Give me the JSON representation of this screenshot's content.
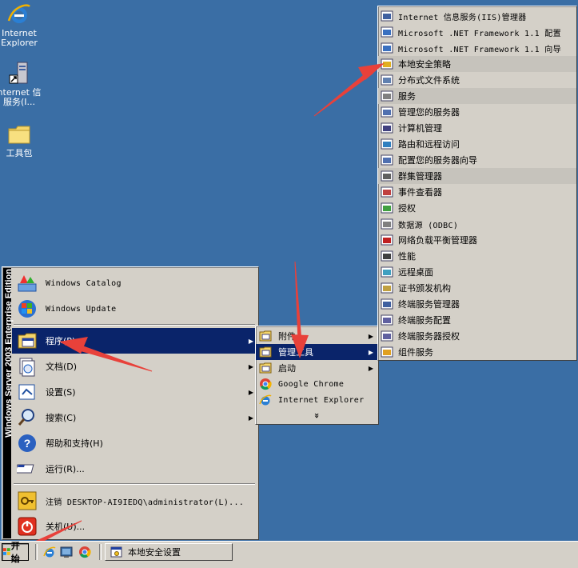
{
  "desktop": {
    "icons": [
      {
        "label1": "Internet",
        "label2": "Explorer",
        "icon": "ie-icon"
      },
      {
        "label1": "nternet 信",
        "label2": "服务(I...",
        "icon": "iis-icon"
      },
      {
        "label1": "工具包",
        "label2": "",
        "icon": "folder-icon"
      }
    ]
  },
  "start_menu": {
    "banner": "Windows Server 2003 Enterprise Edition",
    "items": [
      {
        "label": "Windows Catalog",
        "icon": "windows-catalog-icon"
      },
      {
        "label": "Windows Update",
        "icon": "windows-update-icon"
      },
      {
        "label": "程序(P)",
        "icon": "programs-icon"
      },
      {
        "label": "文档(D)",
        "icon": "documents-icon"
      },
      {
        "label": "设置(S)",
        "icon": "settings-icon"
      },
      {
        "label": "搜索(C)",
        "icon": "search-icon"
      },
      {
        "label": "帮助和支持(H)",
        "icon": "help-icon"
      },
      {
        "label": "运行(R)...",
        "icon": "run-icon"
      },
      {
        "label": "注销 DESKTOP-AI9IEDQ\\administrator(L)...",
        "icon": "logoff-icon"
      },
      {
        "label": "关机(U)...",
        "icon": "shutdown-icon"
      }
    ]
  },
  "programs_menu": {
    "items": [
      {
        "label": "附件"
      },
      {
        "label": "管理工具"
      },
      {
        "label": "启动"
      },
      {
        "label": "Google Chrome"
      },
      {
        "label": "Internet Explorer"
      }
    ],
    "expand": "»"
  },
  "admin_tools_menu": {
    "items": [
      {
        "label": "Internet 信息服务(IIS)管理器"
      },
      {
        "label": "Microsoft .NET Framework 1.1 配置"
      },
      {
        "label": "Microsoft .NET Framework 1.1 向导"
      },
      {
        "label": "本地安全策略"
      },
      {
        "label": "分布式文件系统"
      },
      {
        "label": "服务"
      },
      {
        "label": "管理您的服务器"
      },
      {
        "label": "计算机管理"
      },
      {
        "label": "路由和远程访问"
      },
      {
        "label": "配置您的服务器向导"
      },
      {
        "label": "群集管理器"
      },
      {
        "label": "事件查看器"
      },
      {
        "label": "授权"
      },
      {
        "label": "数据源 (ODBC)"
      },
      {
        "label": "网络负载平衡管理器"
      },
      {
        "label": "性能"
      },
      {
        "label": "远程桌面"
      },
      {
        "label": "证书颁发机构"
      },
      {
        "label": "终端服务管理器"
      },
      {
        "label": "终端服务配置"
      },
      {
        "label": "终端服务器授权"
      },
      {
        "label": "组件服务"
      }
    ]
  },
  "taskbar": {
    "start_label": "开始",
    "task_label": "本地安全设置"
  },
  "colors": {
    "desktop": "#3a6ea5",
    "highlight": "#0a246a",
    "annotation_arrow": "#e8413a"
  }
}
